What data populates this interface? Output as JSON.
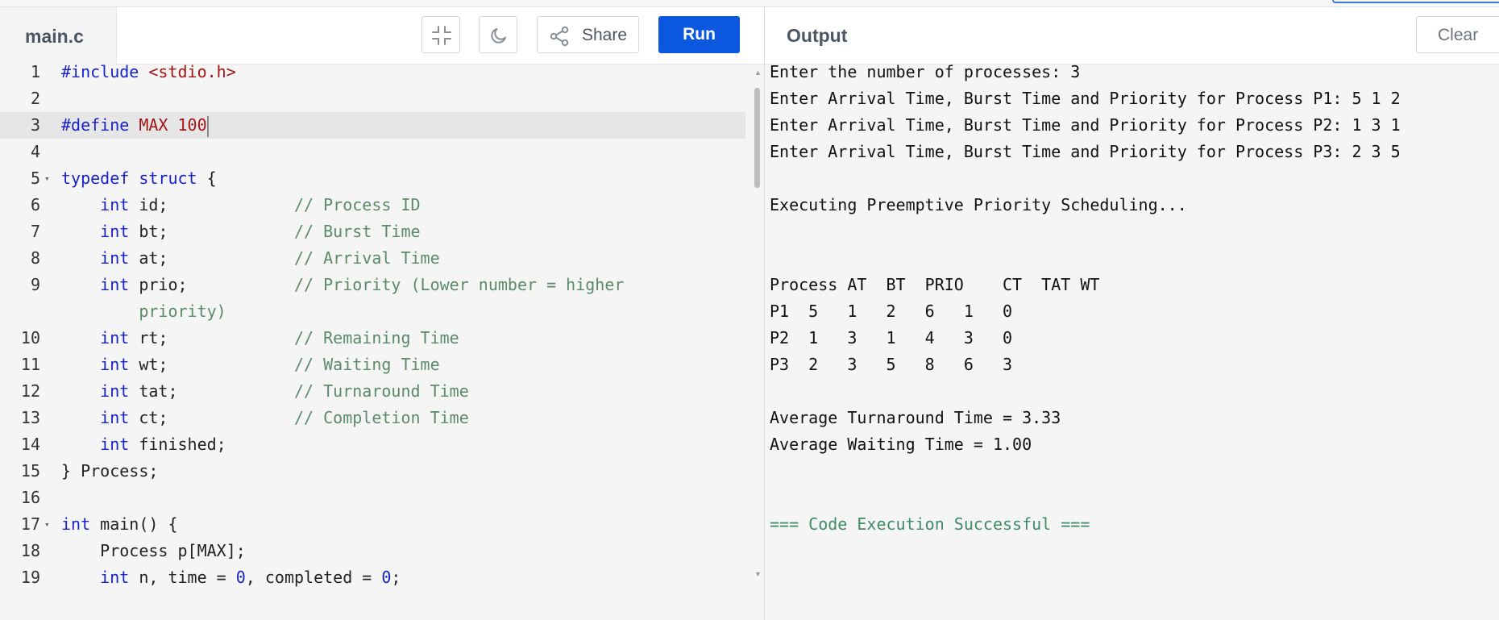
{
  "editor": {
    "file_tab": "main.c",
    "toolbar": {
      "share_label": "Share",
      "run_label": "Run"
    },
    "lines": [
      {
        "num": "1",
        "tokens": [
          {
            "cls": "k",
            "text": "#include "
          },
          {
            "cls": "s",
            "text": "<stdio.h>"
          }
        ]
      },
      {
        "num": "2",
        "tokens": []
      },
      {
        "num": "3",
        "tokens": [
          {
            "cls": "k",
            "text": "#define "
          },
          {
            "cls": "s",
            "text": "MAX 100"
          }
        ]
      },
      {
        "num": "4",
        "tokens": []
      },
      {
        "num": "5",
        "tokens": [
          {
            "cls": "k",
            "text": "typedef struct"
          },
          {
            "cls": "t",
            "text": " {"
          }
        ]
      },
      {
        "num": "6",
        "tokens": [
          {
            "cls": "t",
            "text": "    "
          },
          {
            "cls": "k",
            "text": "int"
          },
          {
            "cls": "t",
            "text": " id;             "
          },
          {
            "cls": "c",
            "text": "// Process ID"
          }
        ]
      },
      {
        "num": "7",
        "tokens": [
          {
            "cls": "t",
            "text": "    "
          },
          {
            "cls": "k",
            "text": "int"
          },
          {
            "cls": "t",
            "text": " bt;             "
          },
          {
            "cls": "c",
            "text": "// Burst Time"
          }
        ]
      },
      {
        "num": "8",
        "tokens": [
          {
            "cls": "t",
            "text": "    "
          },
          {
            "cls": "k",
            "text": "int"
          },
          {
            "cls": "t",
            "text": " at;             "
          },
          {
            "cls": "c",
            "text": "// Arrival Time"
          }
        ]
      },
      {
        "num": "9",
        "tokens": [
          {
            "cls": "t",
            "text": "    "
          },
          {
            "cls": "k",
            "text": "int"
          },
          {
            "cls": "t",
            "text": " prio;           "
          },
          {
            "cls": "c",
            "text": "// Priority (Lower number = higher"
          }
        ]
      },
      {
        "num": "",
        "tokens": [
          {
            "cls": "c",
            "text": "        priority)"
          }
        ]
      },
      {
        "num": "10",
        "tokens": [
          {
            "cls": "t",
            "text": "    "
          },
          {
            "cls": "k",
            "text": "int"
          },
          {
            "cls": "t",
            "text": " rt;             "
          },
          {
            "cls": "c",
            "text": "// Remaining Time"
          }
        ]
      },
      {
        "num": "11",
        "tokens": [
          {
            "cls": "t",
            "text": "    "
          },
          {
            "cls": "k",
            "text": "int"
          },
          {
            "cls": "t",
            "text": " wt;             "
          },
          {
            "cls": "c",
            "text": "// Waiting Time"
          }
        ]
      },
      {
        "num": "12",
        "tokens": [
          {
            "cls": "t",
            "text": "    "
          },
          {
            "cls": "k",
            "text": "int"
          },
          {
            "cls": "t",
            "text": " tat;            "
          },
          {
            "cls": "c",
            "text": "// Turnaround Time"
          }
        ]
      },
      {
        "num": "13",
        "tokens": [
          {
            "cls": "t",
            "text": "    "
          },
          {
            "cls": "k",
            "text": "int"
          },
          {
            "cls": "t",
            "text": " ct;             "
          },
          {
            "cls": "c",
            "text": "// Completion Time"
          }
        ]
      },
      {
        "num": "14",
        "tokens": [
          {
            "cls": "t",
            "text": "    "
          },
          {
            "cls": "k",
            "text": "int"
          },
          {
            "cls": "t",
            "text": " finished;"
          }
        ]
      },
      {
        "num": "15",
        "tokens": [
          {
            "cls": "t",
            "text": "} Process;"
          }
        ]
      },
      {
        "num": "16",
        "tokens": []
      },
      {
        "num": "17",
        "tokens": [
          {
            "cls": "k",
            "text": "int"
          },
          {
            "cls": "t",
            "text": " main() {"
          }
        ]
      },
      {
        "num": "18",
        "tokens": [
          {
            "cls": "t",
            "text": "    Process p[MAX];"
          }
        ]
      },
      {
        "num": "19",
        "tokens": [
          {
            "cls": "t",
            "text": "    "
          },
          {
            "cls": "k",
            "text": "int"
          },
          {
            "cls": "t",
            "text": " n, time = "
          },
          {
            "cls": "n",
            "text": "0"
          },
          {
            "cls": "t",
            "text": ", completed = "
          },
          {
            "cls": "n",
            "text": "0"
          },
          {
            "cls": "t",
            "text": ";"
          }
        ]
      }
    ],
    "active_line": "3",
    "fold_lines": [
      "5",
      "17"
    ]
  },
  "output": {
    "title": "Output",
    "clear_label": "Clear",
    "lines": [
      "Enter the number of processes: 3",
      "Enter Arrival Time, Burst Time and Priority for Process P1: 5 1 2",
      "Enter Arrival Time, Burst Time and Priority for Process P2: 1 3 1",
      "Enter Arrival Time, Burst Time and Priority for Process P3: 2 3 5",
      "",
      "Executing Preemptive Priority Scheduling...",
      "",
      "",
      "Process AT  BT  PRIO    CT  TAT WT",
      "P1  5   1   2   6   1   0",
      "P2  1   3   1   4   3   0",
      "P3  2   3   5   8   6   3",
      "",
      "Average Turnaround Time = 3.33",
      "Average Waiting Time = 1.00",
      "",
      "",
      "=== Code Execution Successful ==="
    ],
    "success_line": "=== Code Execution Successful ==="
  },
  "icons": {
    "collapse": "collapse-icon",
    "theme": "moon-icon",
    "share": "share-icon"
  },
  "colors": {
    "run_button": "#0b57e0",
    "keyword": "#1722c8",
    "string": "#a31515",
    "comment": "#5a8a6a",
    "success": "#3f8a68"
  }
}
